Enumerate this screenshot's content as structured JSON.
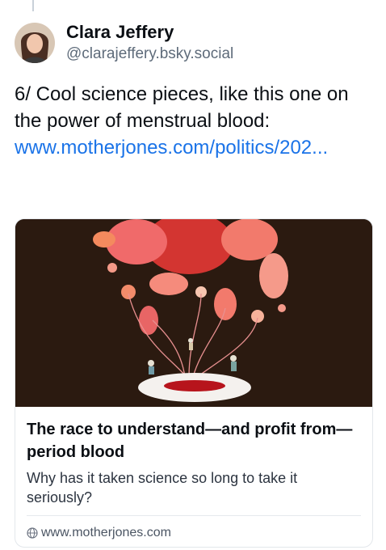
{
  "post": {
    "author": {
      "display_name": "Clara Jeffery",
      "handle": "@clarajeffery.bsky.social"
    },
    "text": "6/ Cool science pieces, like this one on the power of menstrual blood:",
    "link_text": "www.motherjones.com/politics/202..."
  },
  "link_card": {
    "title": "The race to understand—and profit from—period blood",
    "description": "Why has it taken science so long to take it seriously?",
    "domain": "www.motherjones.com",
    "image_icon": "illustration-red-blood-plume",
    "domain_icon": "globe-icon"
  },
  "colors": {
    "link": "#1a73e8",
    "image_bg": "#2b1a10",
    "accent_red": "#e53935"
  }
}
